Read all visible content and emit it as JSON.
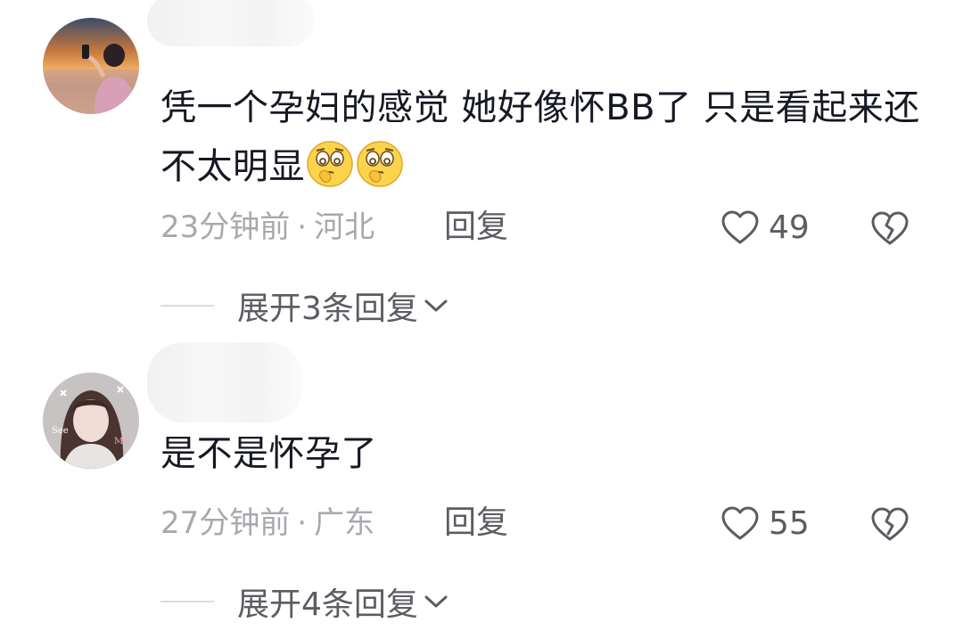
{
  "comments": [
    {
      "avatar_icon": "avatar-sunset-girl",
      "text": "凭一个孕妇的感觉  她好像怀BB了   只是看起来还不太明显",
      "emoji_icon": "thinking-emoji",
      "emoji_count": 2,
      "time": "23分钟前",
      "separator": "·",
      "location": "河北",
      "reply_label": "回复",
      "likes": "49",
      "expand_label": "展开3条回复"
    },
    {
      "avatar_icon": "avatar-girl-selfie",
      "avatar_texts": [
        "See",
        "Me"
      ],
      "text": "是不是怀孕了",
      "time": "27分钟前",
      "separator": "·",
      "location": "广东",
      "reply_label": "回复",
      "likes": "55",
      "expand_label": "展开4条回复"
    }
  ],
  "colors": {
    "text_primary": "#161823",
    "text_secondary": "#a8a9ad",
    "text_action": "#5b5d63",
    "divider": "#dcdce0"
  }
}
